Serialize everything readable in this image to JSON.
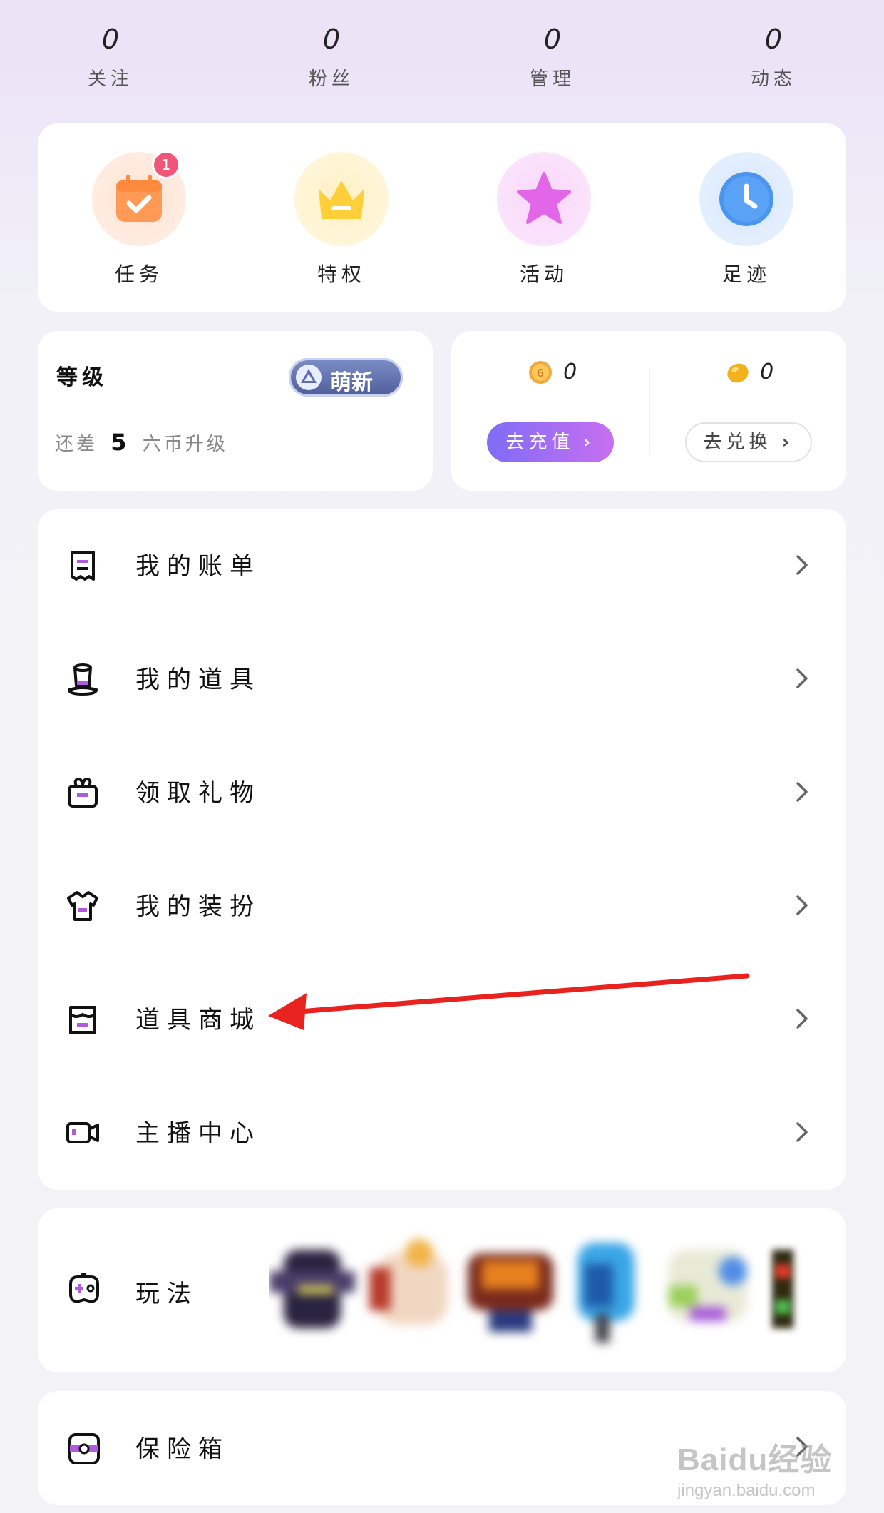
{
  "stats": [
    {
      "value": "0",
      "label": "关注"
    },
    {
      "value": "0",
      "label": "粉丝"
    },
    {
      "value": "0",
      "label": "管理"
    },
    {
      "value": "0",
      "label": "动态"
    }
  ],
  "quick": {
    "items": [
      {
        "label": "任务",
        "badge": "1"
      },
      {
        "label": "特权"
      },
      {
        "label": "活动"
      },
      {
        "label": "足迹"
      }
    ]
  },
  "level": {
    "title": "等级",
    "badge": "萌新",
    "hint_prefix": "还差",
    "hint_number": "5",
    "hint_suffix": "六币升级"
  },
  "coins": {
    "six_coin": "0",
    "bean": "0",
    "recharge_label": "去充值",
    "exchange_label": "去兑换"
  },
  "menu": {
    "items": [
      {
        "label": "我的账单"
      },
      {
        "label": "我的道具"
      },
      {
        "label": "领取礼物"
      },
      {
        "label": "我的装扮"
      },
      {
        "label": "道具商城"
      },
      {
        "label": "主播中心"
      }
    ]
  },
  "play": {
    "label": "玩法"
  },
  "safe": {
    "label": "保险箱"
  },
  "watermark": {
    "logo": "Baidu经验",
    "url": "jingyan.baidu.com"
  },
  "colors": {
    "accent": "#8a6cf5",
    "arrow": "#e8231f",
    "badge": "#f15577"
  }
}
